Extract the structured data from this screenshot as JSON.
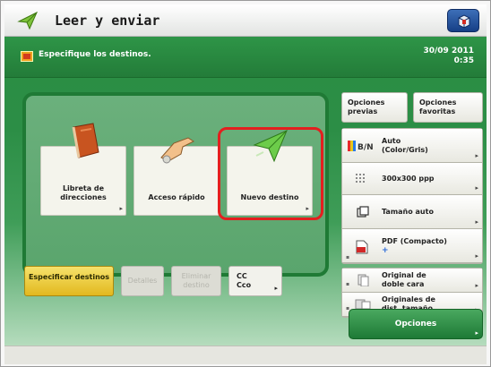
{
  "titlebar": {
    "title": "Leer y enviar",
    "title_icon": "send-arrow-icon",
    "settings_icon": "machine-settings-icon"
  },
  "status": {
    "message": "Especifique los destinos.",
    "date": "30/09 2011",
    "time": "0:35"
  },
  "destinations": {
    "address_book": "Libreta de direcciones",
    "quick_access": "Acceso rápido",
    "new_destination": "Nuevo destino"
  },
  "actions": {
    "specify": "Especificar destinos",
    "details": "Detalles",
    "remove": "Eliminar destino",
    "cc_line1": "CC",
    "cc_line2": "Cco"
  },
  "settings": {
    "previous_options": "Opciones previas",
    "favorite_options": "Opciones favoritas",
    "color_line1": "Auto",
    "color_line2": "(Color/Gris)",
    "color_icon_label": "B/N",
    "resolution": "300x300 ppp",
    "scan_size": "Tamaño auto",
    "format_line1": "PDF (Compacto)",
    "duplex_line1": "Original de",
    "duplex_line2": "doble cara",
    "mixed_line1": "Originales de",
    "mixed_line2": "dist. tamaño",
    "options": "Opciones"
  },
  "colors": {
    "accent_green": "#2a8f43",
    "highlight_red": "#e41f1f",
    "selected_yellow": "#f0cc3a"
  }
}
